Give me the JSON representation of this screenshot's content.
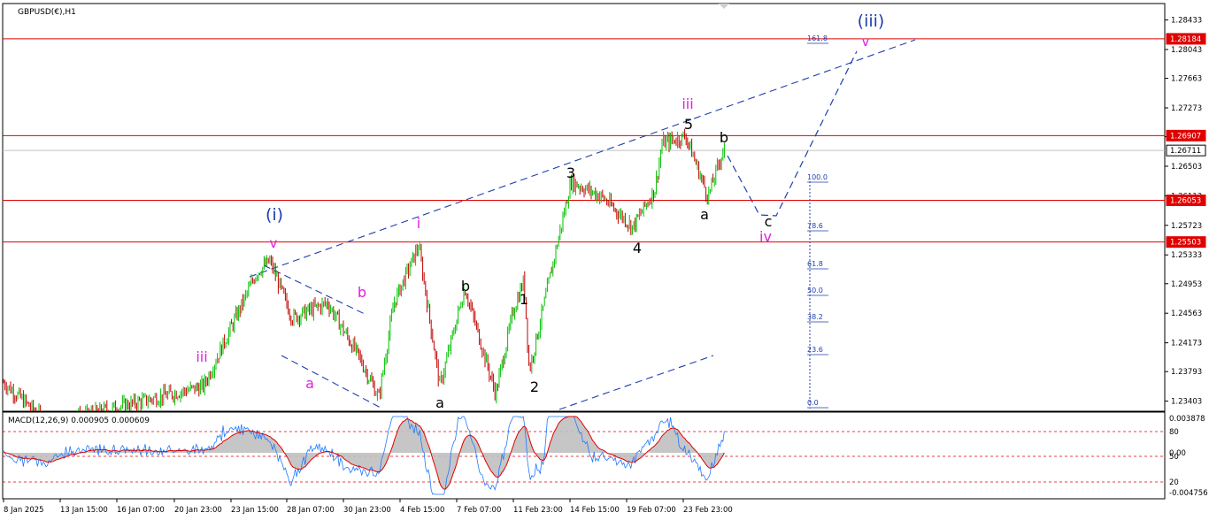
{
  "symbol_title": "GBPUSD(€),H1",
  "macd_title": "MACD(12,26,9) 0.000905 0.000609",
  "colors": {
    "up_candle": "#00c000",
    "down_candle": "#c00000",
    "hline": "#e00000",
    "wave_pink": "#e020e0",
    "wave_navy": "#1e3fae",
    "wave_black": "#000000",
    "trend_dash": "#1e3fae",
    "macd_line": "#1e78ff",
    "signal_line": "#e00000",
    "hist_fill": "#c0c0c0"
  },
  "price_axis": {
    "labels": [
      "1.28433",
      "1.28043",
      "1.27663",
      "1.27273",
      "1.26893",
      "1.26503",
      "1.26113",
      "1.25723",
      "1.25333",
      "1.24953",
      "1.24563",
      "1.24173",
      "1.23793",
      "1.23403"
    ],
    "range": [
      1.2327,
      1.2865
    ]
  },
  "price_tags": [
    {
      "value": "1.28184",
      "type": "red"
    },
    {
      "value": "1.26907",
      "type": "red"
    },
    {
      "value": "1.26711",
      "type": "current"
    },
    {
      "value": "1.26053",
      "type": "red"
    },
    {
      "value": "1.25503",
      "type": "red"
    }
  ],
  "fib_labels": [
    "161.8",
    "100.0",
    "78.6",
    "61.8",
    "50.0",
    "38.2",
    "23.6",
    "0.0"
  ],
  "macd_axis": {
    "labels": [
      "0.003878",
      "80",
      "0.00",
      "50",
      "20",
      "-0.004756"
    ]
  },
  "time_axis": {
    "labels": [
      "8 Jan 2025",
      "13 Jan 15:00",
      "16 Jan 07:00",
      "20 Jan 23:00",
      "23 Jan 15:00",
      "28 Jan 07:00",
      "30 Jan 23:00",
      "4 Feb 15:00",
      "7 Feb 07:00",
      "11 Feb 23:00",
      "14 Feb 15:00",
      "19 Feb 07:00",
      "23 Feb 23:00"
    ]
  },
  "wave_labels": [
    {
      "text": "(iii)",
      "color": "navy"
    },
    {
      "text": "v",
      "color": "pink"
    },
    {
      "text": "iii",
      "color": "pink"
    },
    {
      "text": "5",
      "color": "black"
    },
    {
      "text": "b",
      "color": "black"
    },
    {
      "text": "3",
      "color": "black"
    },
    {
      "text": "a",
      "color": "black"
    },
    {
      "text": "c",
      "color": "black"
    },
    {
      "text": "iv",
      "color": "pink"
    },
    {
      "text": "4",
      "color": "black"
    },
    {
      "text": "(i)",
      "color": "navy"
    },
    {
      "text": "v",
      "color": "pink"
    },
    {
      "text": "i",
      "color": "pink"
    },
    {
      "text": "b",
      "color": "pink"
    },
    {
      "text": "b",
      "color": "black"
    },
    {
      "text": "1",
      "color": "black"
    },
    {
      "text": "iii",
      "color": "pink"
    },
    {
      "text": "a",
      "color": "pink"
    },
    {
      "text": "2",
      "color": "black"
    },
    {
      "text": "a",
      "color": "black"
    }
  ],
  "chart_data": {
    "type": "candlestick",
    "title": "GBPUSD(€),H1",
    "timeframe": "H1",
    "ylim": [
      1.2327,
      1.2865
    ],
    "key_path": [
      [
        "8 Jan 2025",
        1.2365
      ],
      [
        "13 Jan 15:00",
        1.231
      ],
      [
        "20 Jan 23:00",
        1.236
      ],
      [
        "23 Jan 15:00",
        1.252
      ],
      [
        "28 Jan 07:00",
        1.244
      ],
      [
        "30 Jan 23:00",
        1.2345
      ],
      [
        "4 Feb 15:00",
        1.2545
      ],
      [
        "7 Feb 07:00",
        1.239
      ],
      [
        "11 Feb 23:00",
        1.247
      ],
      [
        "14 Feb 15:00",
        1.263
      ],
      [
        "19 Feb 07:00",
        1.268
      ],
      [
        "23 Feb 23:00",
        1.261
      ]
    ],
    "horizontal_levels": [
      1.28184,
      1.26907,
      1.26053,
      1.25503
    ],
    "current_price": 1.26711,
    "fib_levels": [
      "161.8",
      "100.0",
      "78.6",
      "61.8",
      "50.0",
      "38.2",
      "23.6",
      "0.0"
    ],
    "macd": {
      "params": "12,26,9",
      "macd_value": 0.000905,
      "signal_value": 0.000609,
      "ylim": [
        -0.004756,
        0.003878
      ]
    }
  }
}
